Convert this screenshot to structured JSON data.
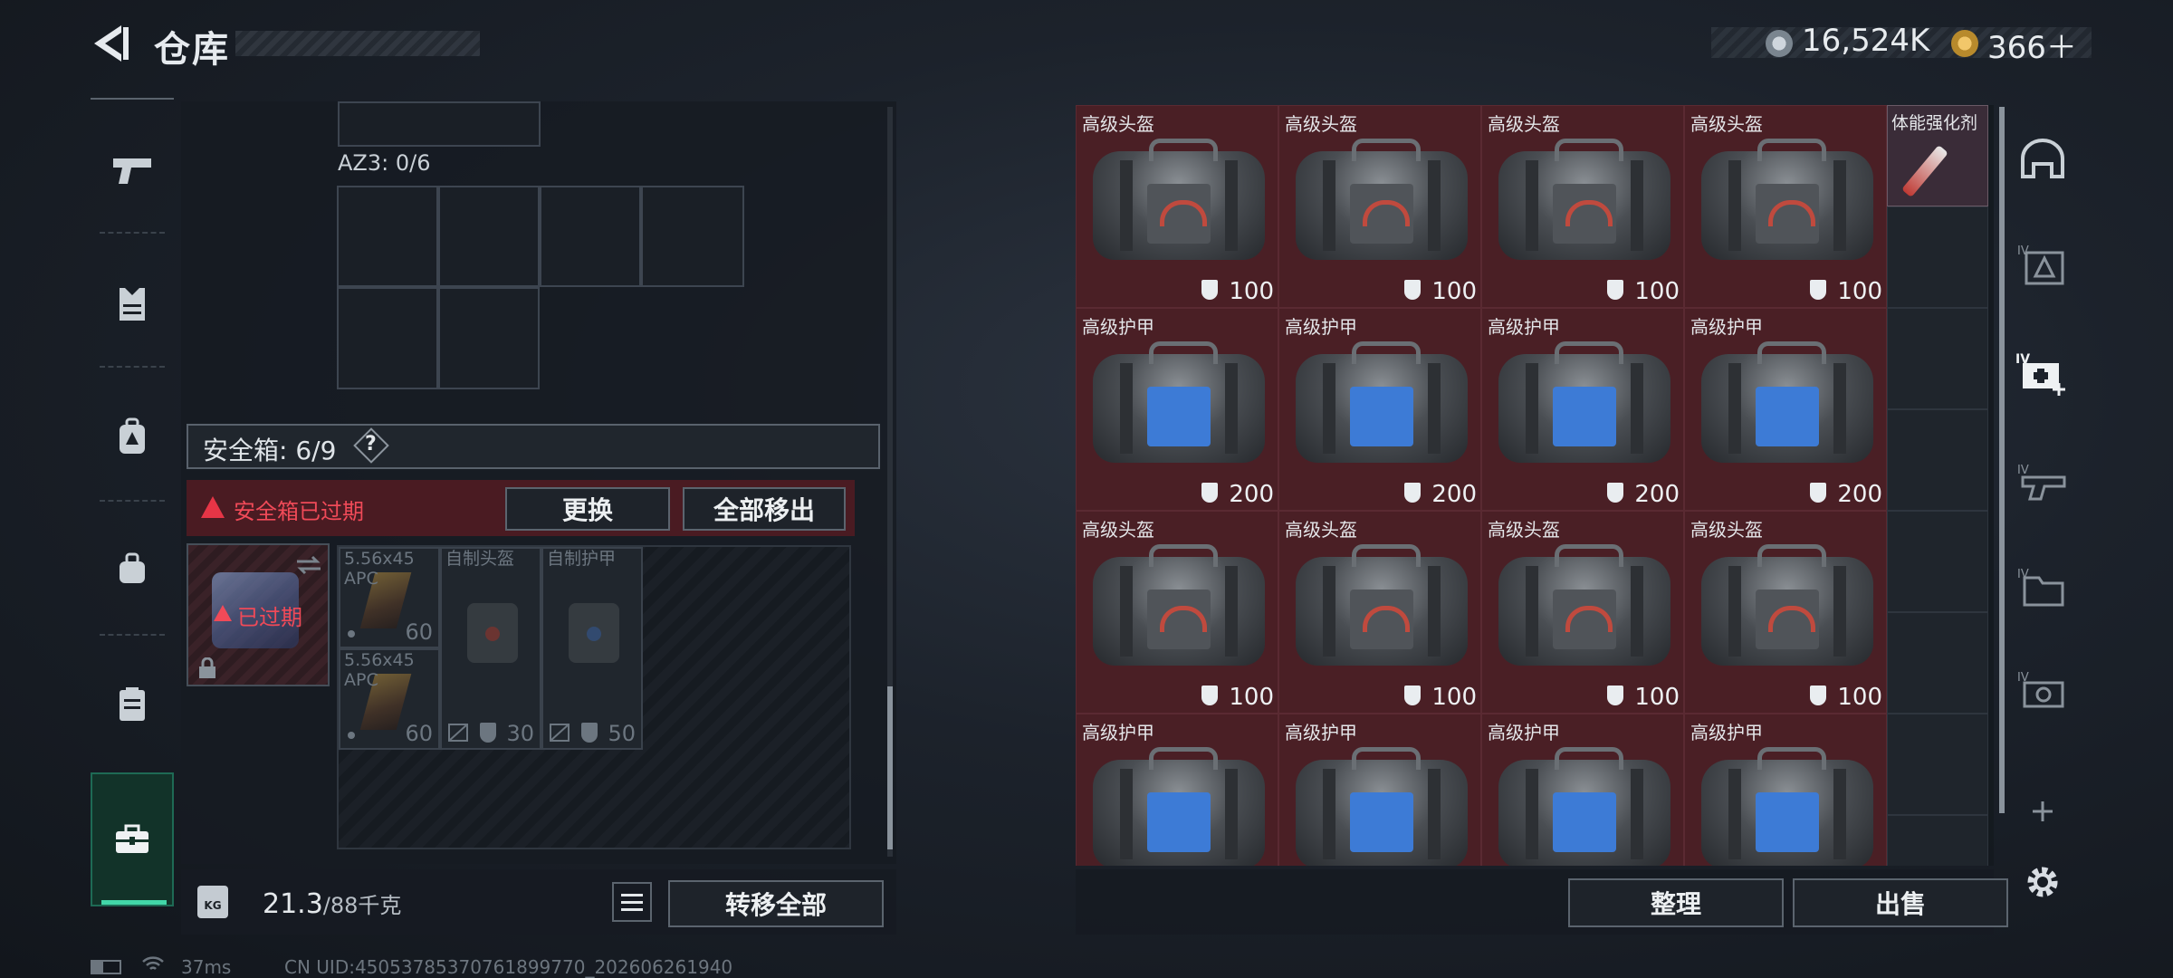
{
  "header": {
    "title": "仓库",
    "currency1": "16,524K",
    "currency2": "366＋"
  },
  "left_nav": [
    "pistol-icon",
    "armor-vest-icon",
    "backpack-icon",
    "pouch-icon",
    "clipboard-icon",
    "toolbox-icon"
  ],
  "storage": {
    "az3_label": "AZ3: 0/6",
    "safe_label": "安全箱: 6/9",
    "help": "?",
    "expired_warning": "安全箱已过期",
    "replace_button": "更换",
    "move_all_out_button": "全部移出",
    "case_status": "已过期",
    "items": [
      {
        "label": "5.56x45\nAPC",
        "count": "60"
      },
      {
        "label": "自制头盔",
        "count": "30"
      },
      {
        "label": "自制护甲",
        "count": "50"
      },
      {
        "label": "5.56x45\nAPC",
        "count": "60"
      }
    ]
  },
  "bottom_left": {
    "kg": "KG",
    "weight_current": "21.3",
    "weight_max": "/88千克",
    "transfer_all_button": "转移全部"
  },
  "footer": {
    "ping": "37ms",
    "uid": "CN UID:450537853707618997​70_202606261940"
  },
  "inventory": {
    "rows": [
      [
        {
          "label": "高级头盔",
          "value": "100",
          "color": "red"
        },
        {
          "label": "高级头盔",
          "value": "100",
          "color": "red"
        },
        {
          "label": "高级头盔",
          "value": "100",
          "color": "red"
        },
        {
          "label": "高级头盔",
          "value": "100",
          "color": "red"
        }
      ],
      [
        {
          "label": "高级护甲",
          "value": "200",
          "color": "blue"
        },
        {
          "label": "高级护甲",
          "value": "200",
          "color": "blue"
        },
        {
          "label": "高级护甲",
          "value": "200",
          "color": "blue"
        },
        {
          "label": "高级护甲",
          "value": "200",
          "color": "blue"
        }
      ],
      [
        {
          "label": "高级头盔",
          "value": "100",
          "color": "red"
        },
        {
          "label": "高级头盔",
          "value": "100",
          "color": "red"
        },
        {
          "label": "高级头盔",
          "value": "100",
          "color": "red"
        },
        {
          "label": "高级头盔",
          "value": "100",
          "color": "red"
        }
      ],
      [
        {
          "label": "高级护甲",
          "value": "",
          "color": "blue"
        },
        {
          "label": "高级护甲",
          "value": "",
          "color": "blue"
        },
        {
          "label": "高级护甲",
          "value": "",
          "color": "blue"
        },
        {
          "label": "高级护甲",
          "value": "",
          "color": "blue"
        }
      ]
    ],
    "stimulant_label": "体能强化剂",
    "sort_button": "整理",
    "sell_button": "出售"
  },
  "right_nav": [
    "helmet-slot-icon",
    "tier4-armor-icon",
    "tier4-medkit-add-icon",
    "tier4-weapon-icon",
    "tier4-folder-icon",
    "tier4-gear-case-icon",
    "add-icon"
  ],
  "colors": {
    "accent": "#42d6a8",
    "warning": "#f04a58",
    "cell_bg": "#4a1f25"
  }
}
